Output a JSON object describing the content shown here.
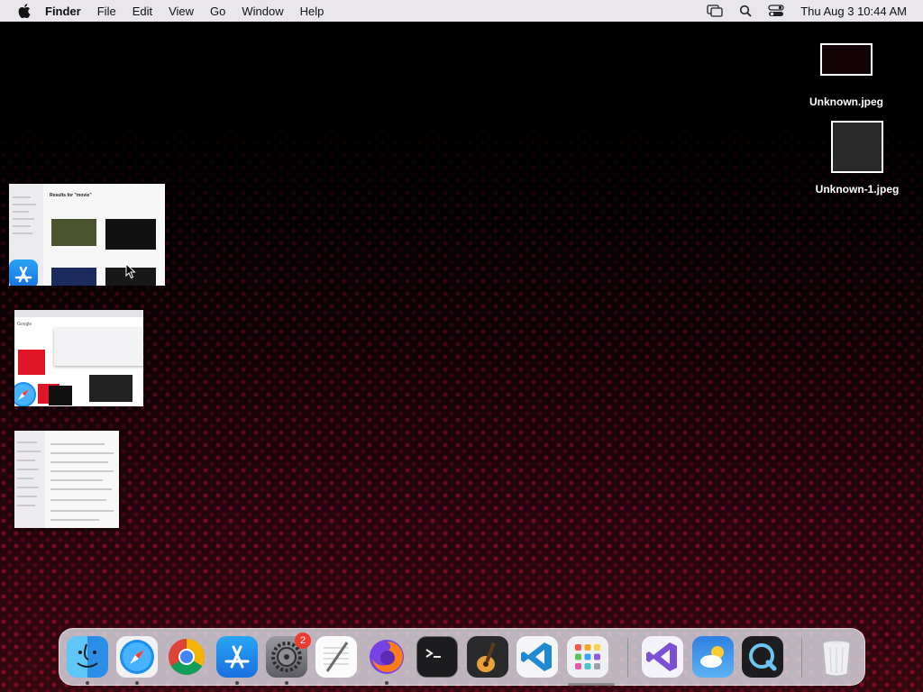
{
  "menubar": {
    "app_name": "Finder",
    "menus": [
      "File",
      "Edit",
      "View",
      "Go",
      "Window",
      "Help"
    ],
    "clock": "Thu Aug 3  10:44 AM",
    "status_icons": [
      "screen-mirroring-icon",
      "spotlight-search-icon",
      "control-center-icon"
    ]
  },
  "desktop": {
    "files": [
      {
        "name": "Unknown.jpeg"
      },
      {
        "name": "Unknown-1.jpeg"
      }
    ]
  },
  "windows": {
    "app_store_title": "Results for \"movie\"",
    "safari_search_label": "Google"
  },
  "dock": {
    "apps": [
      {
        "name": "Finder",
        "icon": "finder-icon",
        "running": true
      },
      {
        "name": "Safari",
        "icon": "safari-icon",
        "running": true
      },
      {
        "name": "Google Chrome",
        "icon": "chrome-icon",
        "running": false
      },
      {
        "name": "App Store",
        "icon": "app-store-icon",
        "running": true
      },
      {
        "name": "System Settings",
        "icon": "system-settings-icon",
        "running": true,
        "badge": "2"
      },
      {
        "name": "TextEdit",
        "icon": "textedit-icon",
        "running": false
      },
      {
        "name": "Firefox",
        "icon": "firefox-icon",
        "running": true
      },
      {
        "name": "Terminal",
        "icon": "terminal-icon",
        "running": false
      },
      {
        "name": "GarageBand",
        "icon": "garageband-icon",
        "running": false
      },
      {
        "name": "Visual Studio Code",
        "icon": "vscode-icon",
        "running": false
      },
      {
        "name": "Launchpad",
        "icon": "launchpad-icon",
        "running": false
      },
      {
        "name": "Visual Studio",
        "icon": "visual-studio-icon",
        "running": false
      },
      {
        "name": "Weather",
        "icon": "weather-icon",
        "running": false
      },
      {
        "name": "QuickTime Player",
        "icon": "quicktime-icon",
        "running": false
      },
      {
        "name": "Trash",
        "icon": "trash-icon",
        "running": false
      }
    ]
  }
}
